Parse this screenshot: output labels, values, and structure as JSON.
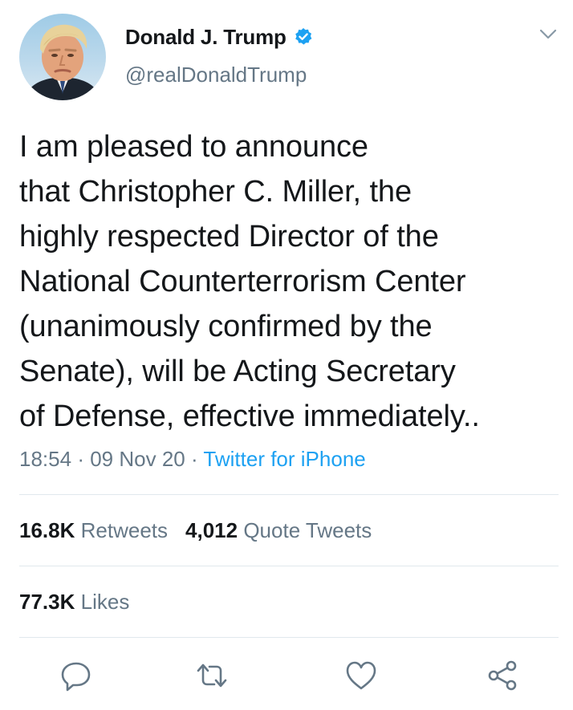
{
  "user": {
    "display_name": "Donald J. Trump",
    "handle": "@realDonaldTrump",
    "verified": true
  },
  "tweet": {
    "text_lines": [
      "I am pleased to announce",
      "that Christopher C. Miller, the",
      "highly respected Director of the",
      "National Counterterrorism Center",
      "(unanimously confirmed by the",
      "Senate), will be Acting Secretary",
      "of Defense, effective immediately.."
    ],
    "time": "18:54",
    "separator": "·",
    "date": "09 Nov 20",
    "source": "Twitter for iPhone"
  },
  "stats": {
    "retweets_count": "16.8K",
    "retweets_label": "Retweets",
    "quotes_count": "4,012",
    "quotes_label": "Quote Tweets",
    "likes_count": "77.3K",
    "likes_label": "Likes"
  },
  "icons": {
    "verified": "verified-badge-icon",
    "more": "chevron-down-icon",
    "reply": "reply-icon",
    "retweet": "retweet-icon",
    "like": "heart-icon",
    "share": "share-icon"
  },
  "colors": {
    "accent": "#1da1f2",
    "text": "#14171a",
    "muted": "#657786",
    "divider": "#e1e8ed"
  }
}
